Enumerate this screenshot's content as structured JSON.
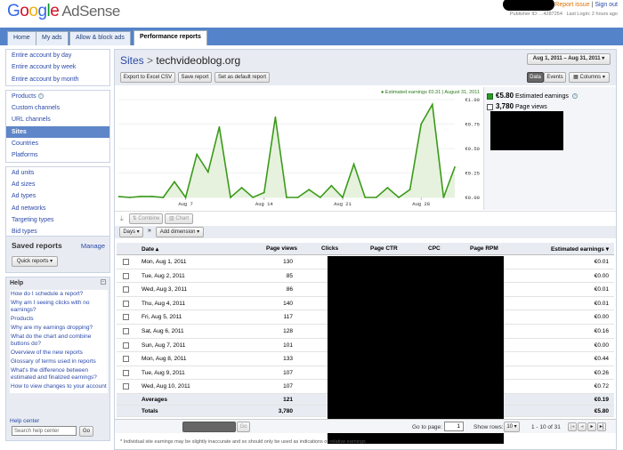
{
  "header": {
    "logo_word": "Google",
    "product": "AdSense",
    "report_issue": "Report issue",
    "sign_out": "Sign out",
    "publisher_prefix": "Publisher ID",
    "publisher_id": "...4287254",
    "last_login": "Last Login: 2 hours ago"
  },
  "tabs": [
    "Home",
    "My ads",
    "Allow & block ads",
    "Performance reports"
  ],
  "active_tab": "Performance reports",
  "sidebar": {
    "group1": [
      "Entire account by day",
      "Entire account by week",
      "Entire account by month"
    ],
    "group2": [
      "Products",
      "Custom channels",
      "URL channels",
      "Sites",
      "Countries",
      "Platforms"
    ],
    "group3": [
      "Ad units",
      "Ad sizes",
      "Ad types",
      "Ad networks",
      "Targeting types",
      "Bid types"
    ],
    "selected": "Sites"
  },
  "saved_reports": {
    "title": "Saved reports",
    "manage": "Manage",
    "quick": "Quick reports"
  },
  "help": {
    "title": "Help",
    "items": [
      "How do I schedule a report?",
      "Why am I seeing clicks with no earnings?",
      "Products",
      "Why are my earnings dropping?",
      "What do the chart and combine buttons do?",
      "Overview of the new reports",
      "Glossary of terms used in reports",
      "What's the difference between estimated and finalized earnings?",
      "How to view changes to your account"
    ],
    "center": "Help center",
    "search_placeholder": "Search help center",
    "go": "Go"
  },
  "page": {
    "crumb": "Sites",
    "sep": ">",
    "site": "techvideoblog.org",
    "export": "Export to Excel CSV",
    "save": "Save report",
    "default": "Set as default report",
    "date_range": "Aug 1, 2011 – Aug 31, 2011",
    "data_btn": "Data",
    "events_btn": "Events",
    "columns_btn": "Columns"
  },
  "chart_data": {
    "type": "line",
    "tooltip": "● Estimated earnings €0.31  |  August 31, 2011",
    "x": [
      "Aug 1",
      "Aug 2",
      "Aug 3",
      "Aug 4",
      "Aug 5",
      "Aug 6",
      "Aug 7",
      "Aug 8",
      "Aug 9",
      "Aug 10",
      "Aug 11",
      "Aug 12",
      "Aug 13",
      "Aug 14",
      "Aug 15",
      "Aug 16",
      "Aug 17",
      "Aug 18",
      "Aug 19",
      "Aug 20",
      "Aug 21",
      "Aug 22",
      "Aug 23",
      "Aug 24",
      "Aug 25",
      "Aug 26",
      "Aug 27",
      "Aug 28",
      "Aug 29",
      "Aug 30",
      "Aug 31"
    ],
    "series": [
      {
        "name": "Estimated earnings",
        "values": [
          0.01,
          0.0,
          0.01,
          0.01,
          0.0,
          0.16,
          0.0,
          0.44,
          0.26,
          0.72,
          0.0,
          0.1,
          0.0,
          0.05,
          0.82,
          0.0,
          0.0,
          0.08,
          0.0,
          0.12,
          0.0,
          0.34,
          0.0,
          0.0,
          0.1,
          0.0,
          0.08,
          0.75,
          0.95,
          0.0,
          0.31
        ]
      }
    ],
    "x_ticks": [
      "Aug 7",
      "Aug 14",
      "Aug 21",
      "Aug 28"
    ],
    "y_ticks": [
      "€1.00",
      "€0.75",
      "€0.50",
      "€0.25",
      "€0.00"
    ],
    "ylim": [
      0,
      1
    ],
    "color": "#3a9a1a"
  },
  "legend": {
    "earnings_value": "€5.80",
    "earnings_label": "Estimated earnings",
    "pageviews_value": "3,780",
    "pageviews_label": "Page views"
  },
  "chart_toolbar": {
    "combine": "Combine",
    "chart": "Chart"
  },
  "filter_toolbar": {
    "days": "Days",
    "arrow": "»",
    "add_dimension": "Add dimension"
  },
  "table": {
    "columns": [
      "Date",
      "Page views",
      "Clicks",
      "Page CTR",
      "CPC",
      "Page RPM",
      "Estimated earnings"
    ],
    "rows": [
      [
        "Mon, Aug 1, 2011",
        "130",
        "€0.01"
      ],
      [
        "Tue, Aug 2, 2011",
        "85",
        "€0.00"
      ],
      [
        "Wed, Aug 3, 2011",
        "86",
        "€0.01"
      ],
      [
        "Thu, Aug 4, 2011",
        "140",
        "€0.01"
      ],
      [
        "Fri, Aug 5, 2011",
        "117",
        "€0.00"
      ],
      [
        "Sat, Aug 6, 2011",
        "128",
        "€0.16"
      ],
      [
        "Sun, Aug 7, 2011",
        "101",
        "€0.00"
      ],
      [
        "Mon, Aug 8, 2011",
        "133",
        "€0.44"
      ],
      [
        "Tue, Aug 9, 2011",
        "107",
        "€0.26"
      ],
      [
        "Wed, Aug 10, 2011",
        "107",
        "€0.72"
      ]
    ],
    "averages_label": "Averages",
    "averages_pv": "121",
    "averages_earn": "€0.19",
    "totals_label": "Totals",
    "totals_pv": "3,780",
    "totals_earn": "€5.80"
  },
  "pager": {
    "go_to_page": "Go to page:",
    "page": "1",
    "go": "Go",
    "show_rows": "Show rows:",
    "rows": "10",
    "range": "1 - 10 of 31"
  },
  "footnote": "* Individual site earnings may be slightly inaccurate and so should only be used as indications of relative earnings."
}
